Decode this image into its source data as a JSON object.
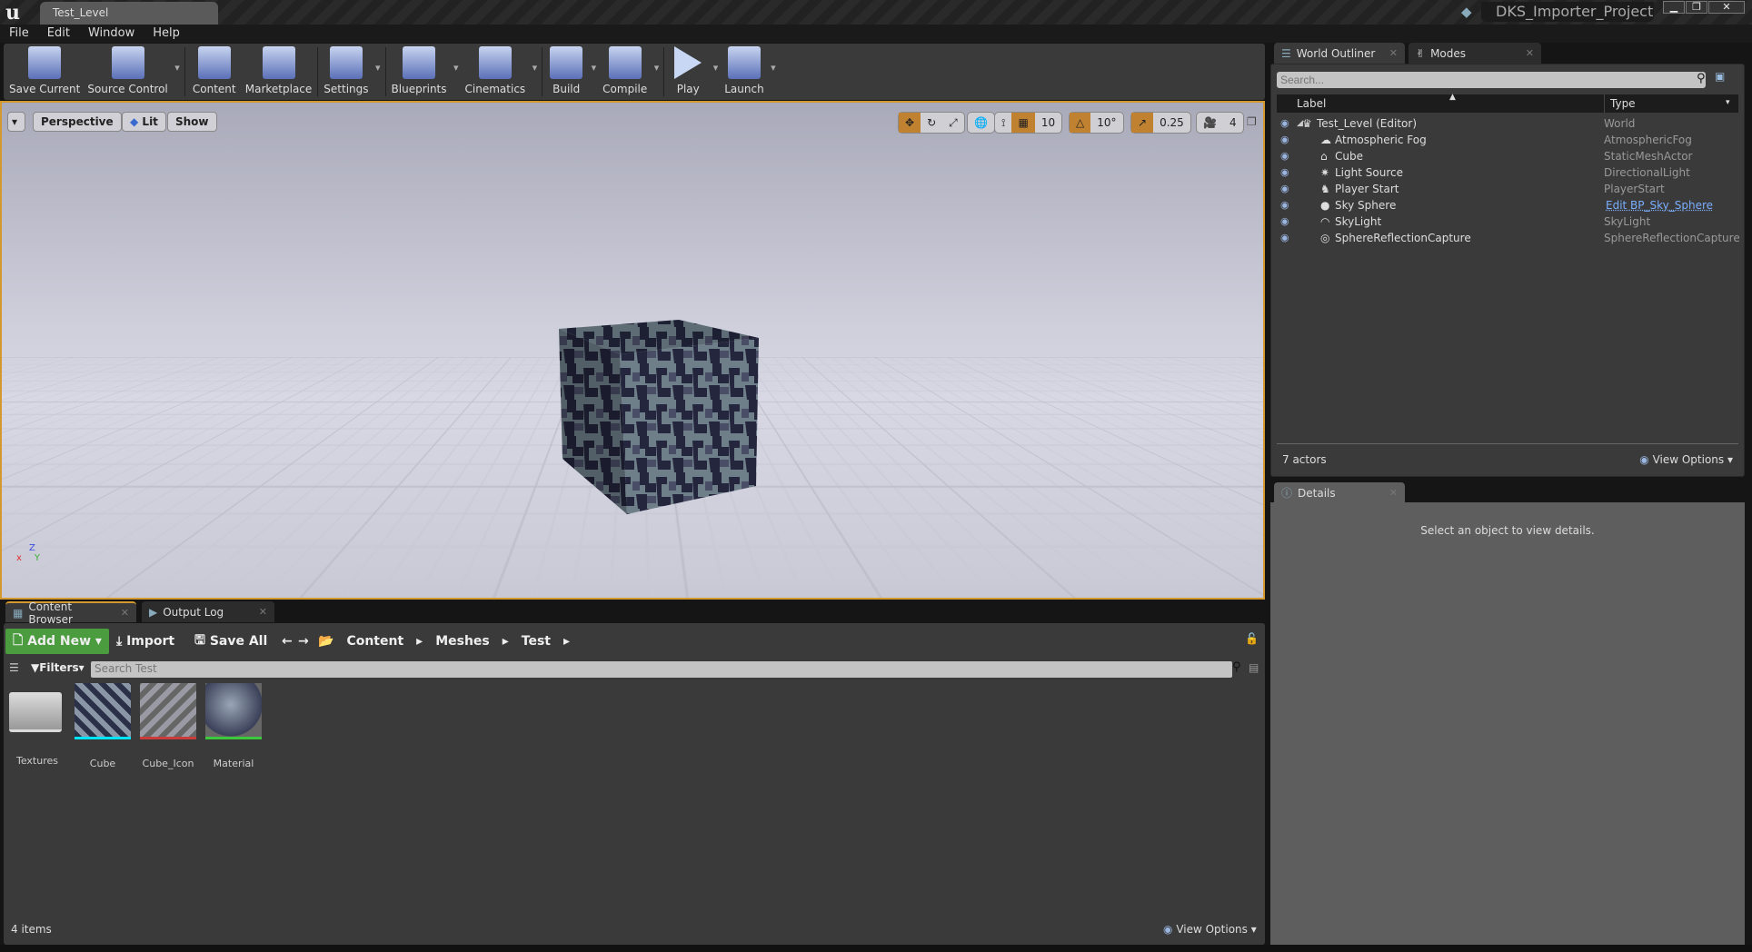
{
  "window": {
    "tab": "Test_Level",
    "project": "DKS_Importer_Project",
    "min": "▁",
    "max": "❐",
    "close": "✕"
  },
  "menu": [
    "File",
    "Edit",
    "Window",
    "Help"
  ],
  "toolbar": [
    {
      "label": "Save Current",
      "icon": "save-icon",
      "dd": false
    },
    {
      "label": "Source Control",
      "icon": "source-control-icon",
      "dd": true
    },
    {
      "label": "Content",
      "icon": "content-icon",
      "dd": false
    },
    {
      "label": "Marketplace",
      "icon": "marketplace-icon",
      "dd": false
    },
    {
      "label": "Settings",
      "icon": "settings-icon",
      "dd": true
    },
    {
      "label": "Blueprints",
      "icon": "blueprints-icon",
      "dd": true
    },
    {
      "label": "Cinematics",
      "icon": "cinematics-icon",
      "dd": true
    },
    {
      "label": "Build",
      "icon": "build-icon",
      "dd": true
    },
    {
      "label": "Compile",
      "icon": "compile-icon",
      "dd": true
    },
    {
      "label": "Play",
      "icon": "play-icon",
      "dd": true
    },
    {
      "label": "Launch",
      "icon": "launch-icon",
      "dd": true
    }
  ],
  "viewport": {
    "perspective": "Perspective",
    "lit": "Lit",
    "show": "Show",
    "grid_snap": "10",
    "rotation_snap": "10°",
    "scale_snap": "0.25",
    "camera_speed": "4",
    "axis_z": "Z",
    "axis_x": "x",
    "axis_y": "Y"
  },
  "outliner": {
    "tab": "World Outliner",
    "modes_tab": "Modes",
    "search_placeholder": "Search...",
    "col_label": "Label",
    "col_type": "Type",
    "rows": [
      {
        "label": "Test_Level (Editor)",
        "type": "World",
        "indent": 0
      },
      {
        "label": "Atmospheric Fog",
        "type": "AtmosphericFog",
        "indent": 1
      },
      {
        "label": "Cube",
        "type": "StaticMeshActor",
        "indent": 1
      },
      {
        "label": "Light Source",
        "type": "DirectionalLight",
        "indent": 1
      },
      {
        "label": "Player Start",
        "type": "PlayerStart",
        "indent": 1
      },
      {
        "label": "Sky Sphere",
        "type": "Edit BP_Sky_Sphere",
        "indent": 1,
        "link": true
      },
      {
        "label": "SkyLight",
        "type": "SkyLight",
        "indent": 1
      },
      {
        "label": "SphereReflectionCapture",
        "type": "SphereReflectionCapture",
        "indent": 1
      }
    ],
    "count": "7 actors",
    "view_options": "View Options"
  },
  "details": {
    "tab": "Details",
    "empty": "Select an object to view details."
  },
  "content_browser": {
    "tab": "Content Browser",
    "output_tab": "Output Log",
    "add_new": "Add New",
    "import": "Import",
    "save_all": "Save All",
    "path": [
      "Content",
      "Meshes",
      "Test"
    ],
    "filters": "Filters",
    "search_placeholder": "Search Test",
    "assets": [
      {
        "name": "Textures",
        "kind": "folder",
        "color": ""
      },
      {
        "name": "Cube",
        "kind": "static-mesh",
        "color": "#00e5ff"
      },
      {
        "name": "Cube_Icon",
        "kind": "texture",
        "color": "#c83c3c"
      },
      {
        "name": "Material",
        "kind": "material",
        "color": "#3cc83c"
      }
    ],
    "count": "4 items",
    "view_options": "View Options"
  },
  "colors": {
    "accent": "#d4992e",
    "add_new": "#4a9c3e",
    "link": "#7aaeff"
  }
}
